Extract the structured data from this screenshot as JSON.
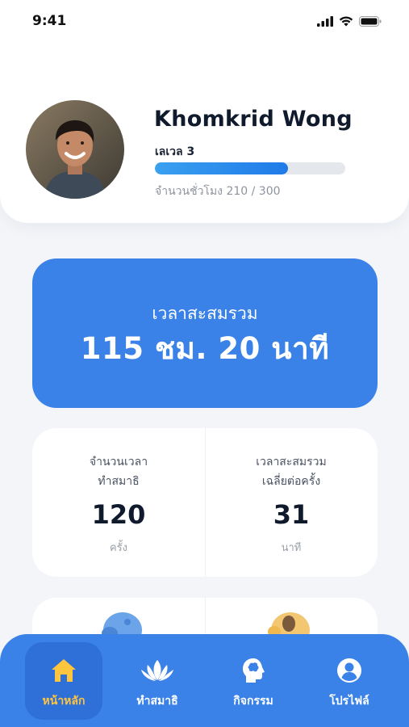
{
  "status_bar": {
    "time": "9:41"
  },
  "profile": {
    "name": "Khomkrid Wong",
    "level": "เลเวล 3",
    "progress": 0.7,
    "hours_text": "จำนวนชั่วโมง 210 / 300"
  },
  "total_time": {
    "label": "เวลาสะสมรวม",
    "value": "115 ชม. 20 นาที"
  },
  "stats": [
    {
      "label": "จำนวนเวลา\nทำสมาธิ",
      "value": "120",
      "unit": "ครั้ง"
    },
    {
      "label": "เวลาสะสมรวม\nเฉลี่ยต่อครั้ง",
      "value": "31",
      "unit": "นาที"
    }
  ],
  "nav": [
    {
      "label": "หน้าหลัก",
      "icon": "home-icon",
      "active": true
    },
    {
      "label": "ทำสมาธิ",
      "icon": "lotus-icon",
      "active": false
    },
    {
      "label": "กิจกรรม",
      "icon": "brain-head-icon",
      "active": false
    },
    {
      "label": "โปรไฟล์",
      "icon": "user-icon",
      "active": false
    }
  ],
  "colors": {
    "primary": "#3b82e8",
    "active_nav_bg": "#2f70d8",
    "active_label": "#ffc53d",
    "progress": "#1f7ae8"
  }
}
